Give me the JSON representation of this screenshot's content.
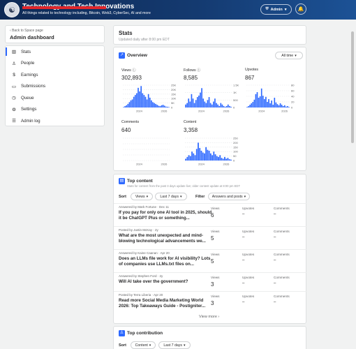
{
  "header": {
    "space_title": "Technology and Tech Innovations",
    "subtitle": "All things related to technology including, Bitcoin, Web3, CyberSec, AI and more",
    "admin_label": "Admin",
    "admin_chevron": "▾",
    "logo_glyph": "☯",
    "bell_glyph": "🔔",
    "redaction_color": "#e0262b"
  },
  "sidebar": {
    "back_label": "Back to Space page",
    "back_arrow": "‹",
    "title": "Admin dashboard",
    "items": [
      {
        "label": "Stats",
        "icon": "stats-icon",
        "glyph": "▥"
      },
      {
        "label": "People",
        "icon": "people-icon",
        "glyph": "♙"
      },
      {
        "label": "Earnings",
        "icon": "earnings-icon",
        "glyph": "$"
      },
      {
        "label": "Submissions",
        "icon": "submissions-icon",
        "glyph": "▭"
      },
      {
        "label": "Queue",
        "icon": "queue-icon",
        "glyph": "◷"
      },
      {
        "label": "Settings",
        "icon": "settings-icon",
        "glyph": "⚙"
      },
      {
        "label": "Admin log",
        "icon": "admin-log-icon",
        "glyph": "☰"
      }
    ]
  },
  "stats": {
    "title": "Stats",
    "subtitle": "Updated daily after 8:00 pm EDT"
  },
  "overview": {
    "title": "Overview",
    "range_label": "All time",
    "range_chevron": "▾",
    "accent": "#2e69ff",
    "metrics": [
      {
        "label": "Views",
        "info": "ⓘ",
        "value": "302,893"
      },
      {
        "label": "Follows",
        "info": "ⓘ",
        "value": "8,585"
      },
      {
        "label": "Upvotes",
        "info": "",
        "value": "867"
      },
      {
        "label": "Comments",
        "info": "",
        "value": "640"
      },
      {
        "label": "Content",
        "info": "",
        "value": "3,358"
      }
    ]
  },
  "chart_data": [
    {
      "type": "bar",
      "title": "Views",
      "x_ticks": [
        "2024",
        "2026"
      ],
      "y_ticks": [
        "25K",
        "20K",
        "15K",
        "10K",
        "5K",
        "0"
      ],
      "ylim": [
        0,
        25000
      ],
      "values": [
        500,
        1500,
        2500,
        4000,
        6000,
        8000,
        9000,
        12000,
        14000,
        16000,
        22000,
        18000,
        24000,
        16000,
        14000,
        12000,
        9000,
        15000,
        11000,
        8000,
        6000,
        5000,
        4000,
        3000,
        2000,
        1500,
        2500,
        3000,
        2000,
        1000,
        800,
        500
      ]
    },
    {
      "type": "bar",
      "title": "Follows",
      "x_ticks": [
        "2024",
        "2026"
      ],
      "y_ticks": [
        "1.5K",
        "1K",
        "500",
        "0"
      ],
      "ylim": [
        0,
        1500
      ],
      "values": [
        200,
        300,
        600,
        400,
        900,
        600,
        300,
        500,
        700,
        800,
        1000,
        1300,
        600,
        400,
        300,
        500,
        700,
        300,
        200,
        400,
        600,
        300,
        200,
        100,
        300,
        200,
        100,
        50,
        100,
        200,
        100,
        50
      ]
    },
    {
      "type": "bar",
      "title": "Upvotes",
      "x_ticks": [
        "2024",
        "2026"
      ],
      "y_ticks": [
        "80",
        "60",
        "40",
        "20",
        "0"
      ],
      "ylim": [
        0,
        80
      ],
      "values": [
        2,
        5,
        10,
        15,
        20,
        28,
        48,
        55,
        35,
        40,
        68,
        42,
        30,
        38,
        20,
        30,
        15,
        25,
        10,
        35,
        18,
        12,
        8,
        15,
        10,
        5,
        8,
        3,
        5,
        2
      ]
    },
    {
      "type": "bar",
      "title": "Comments",
      "x_ticks": [
        "2024",
        "2026"
      ],
      "y_ticks": [
        "",
        "",
        "",
        "",
        ""
      ],
      "ylim": [
        0,
        100
      ],
      "values": []
    },
    {
      "type": "bar",
      "title": "Content",
      "x_ticks": [
        "2024",
        "2026"
      ],
      "y_ticks": [
        "250",
        "200",
        "150",
        "100",
        "50",
        "0"
      ],
      "ylim": [
        0,
        250
      ],
      "values": [
        20,
        40,
        60,
        50,
        100,
        80,
        60,
        130,
        200,
        140,
        110,
        90,
        80,
        150,
        120,
        110,
        80,
        60,
        100,
        70,
        50,
        40,
        60,
        30,
        20,
        40,
        20,
        30,
        15,
        10
      ]
    }
  ],
  "top_content": {
    "title": "Top content",
    "note": "Stats for content from the past 3 days update live; older content update at 8:00 pm EDT",
    "sort_label": "Sort",
    "sort_value": "Views",
    "period_value": "Last 7 days",
    "filter_label": "Filter",
    "filter_value": "Answers and posts",
    "chevron": "▾",
    "col_views": "Views",
    "col_upvotes": "Upvotes",
    "col_comments": "Comments",
    "rows": [
      {
        "meta": "Answered by Mark Fortune · Dec 11",
        "title": "If you pay for only one AI tool in 2025, should it be ChatGPT Plus or something...",
        "views": "6",
        "upvotes": "–",
        "comments": "–"
      },
      {
        "meta": "Posted by Justin McKay · 2y",
        "title": "What are the most unexpected and mind-blowing technological advancements we...",
        "views": "5",
        "upvotes": "–",
        "comments": "–"
      },
      {
        "meta": "Answered by Kaine Caanan · Apr 20",
        "title": "Does an LLMs file work for AI visibility? Lots of companies use LLMs.txt files on...",
        "views": "5",
        "upvotes": "–",
        "comments": "–"
      },
      {
        "meta": "Answered by Stephen Ford · 2y",
        "title": "Will AI take over the government?",
        "views": "3",
        "upvotes": "–",
        "comments": "–"
      },
      {
        "meta": "Posted by Terra Liberia · Apr 20",
        "title": "Read more Social Media Marketing World 2026: Top Takeaways Guide - Postigniter...",
        "views": "3",
        "upvotes": "–",
        "comments": "–"
      }
    ],
    "view_more": "View more ›"
  },
  "top_contribution": {
    "title": "Top contribution",
    "sort_label": "Sort",
    "sort_value": "Content",
    "period_value": "Last 7 days"
  }
}
